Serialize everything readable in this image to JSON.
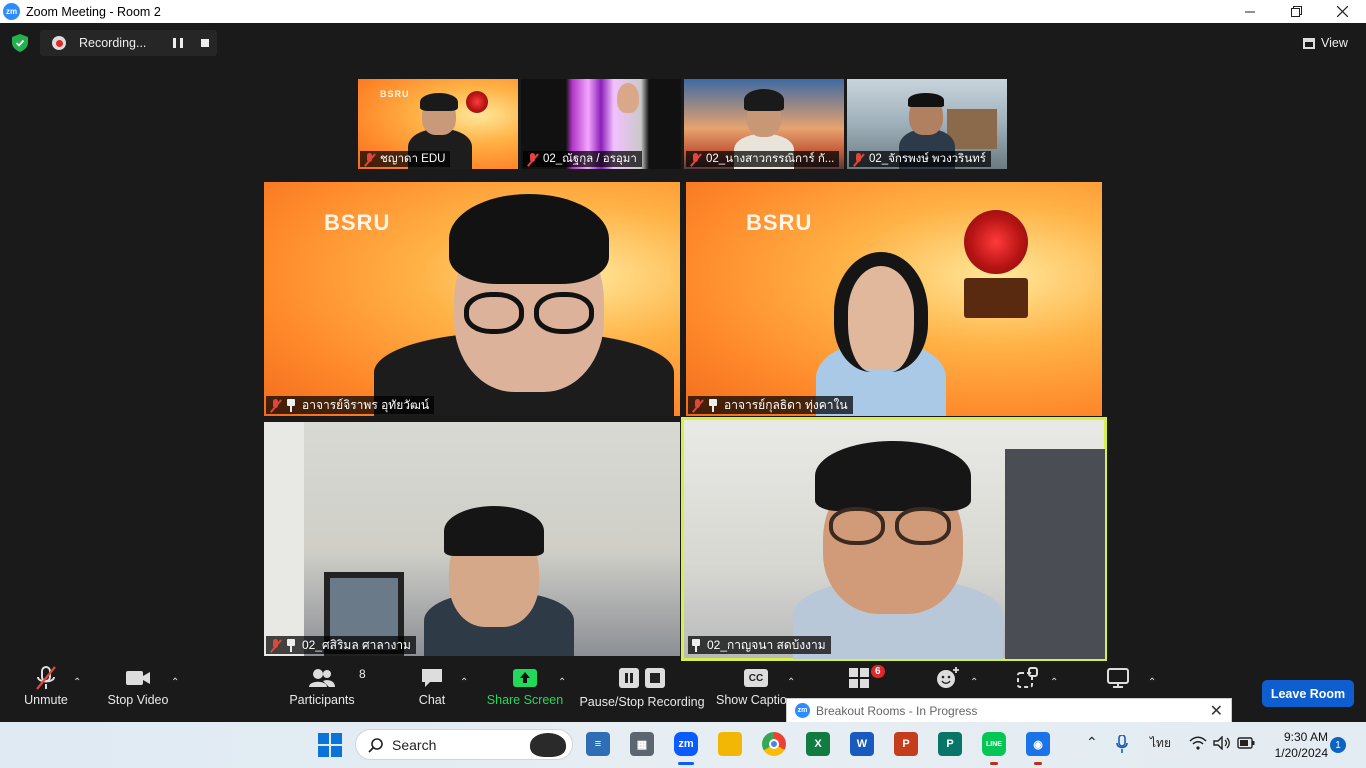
{
  "window": {
    "title": "Zoom Meeting - Room 2",
    "logo_text": "zm"
  },
  "recording": {
    "label": "Recording..."
  },
  "view_label": "View",
  "tiles": {
    "top_strip": [
      {
        "name": "ชญาดา EDU",
        "muted": true
      },
      {
        "name": "02_ณัฐกุล / อรอุมา",
        "muted": true
      },
      {
        "name": "02_นางสาวกรรณิการ์ กั...",
        "muted": true
      },
      {
        "name": "02_จักรพงษ์ พวงวรินทร์",
        "muted": true
      }
    ],
    "grid": [
      {
        "name": "อาจารย์จิราพร อุทัยวัฒน์",
        "muted": true,
        "pinned": true
      },
      {
        "name": "อาจารย์กุลธิดา ทุ่งคาใน",
        "muted": true,
        "pinned": true
      },
      {
        "name": "02_ศสิริมล ศาลางาม",
        "muted": true,
        "pinned": true
      },
      {
        "name": "02_กาญจนา สดบ้งงาม",
        "muted": false,
        "pinned": true,
        "active_speaker": true
      }
    ]
  },
  "toolbar": {
    "unmute": "Unmute",
    "stop_video": "Stop Video",
    "participants": "Participants",
    "participants_count": "8",
    "chat": "Chat",
    "share_screen": "Share Screen",
    "pause_stop_recording": "Pause/Stop Recording",
    "show_captions": "Show Captio",
    "cc_icon_text": "CC",
    "breakout_badge": "6",
    "leave_room": "Leave Room",
    "share_color": "#23d959"
  },
  "breakout_popup": {
    "logo_text": "zm",
    "text": "Breakout Rooms - In Progress"
  },
  "taskbar": {
    "search_placeholder": "Search",
    "language": "ไทย",
    "time": "9:30 AM",
    "date": "1/20/2024",
    "notification_count": "1"
  }
}
